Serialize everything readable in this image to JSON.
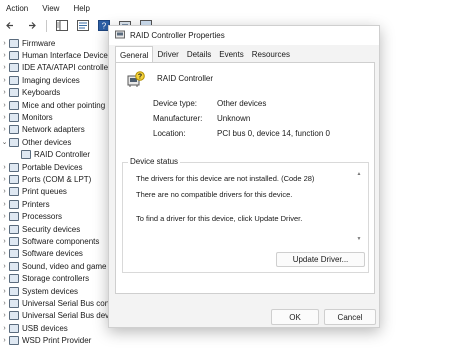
{
  "menubar": {
    "items": [
      "Action",
      "View",
      "Help"
    ]
  },
  "toolbar": {
    "icons": [
      "back-icon",
      "forward-icon",
      "show-hide-tree-icon",
      "properties-icon",
      "help-icon",
      "device-view-icon",
      "monitor-icon"
    ]
  },
  "tree": {
    "items": [
      {
        "label": "Firmware",
        "expanded": false
      },
      {
        "label": "Human Interface Devices",
        "expanded": false
      },
      {
        "label": "IDE ATA/ATAPI controllers",
        "expanded": false
      },
      {
        "label": "Imaging devices",
        "expanded": false
      },
      {
        "label": "Keyboards",
        "expanded": false
      },
      {
        "label": "Mice and other pointing",
        "expanded": false
      },
      {
        "label": "Monitors",
        "expanded": false
      },
      {
        "label": "Network adapters",
        "expanded": false
      },
      {
        "label": "Other devices",
        "expanded": true
      },
      {
        "label": "RAID Controller",
        "child": true
      },
      {
        "label": "Portable Devices",
        "expanded": false
      },
      {
        "label": "Ports (COM & LPT)",
        "expanded": false
      },
      {
        "label": "Print queues",
        "expanded": false
      },
      {
        "label": "Printers",
        "expanded": false
      },
      {
        "label": "Processors",
        "expanded": false
      },
      {
        "label": "Security devices",
        "expanded": false
      },
      {
        "label": "Software components",
        "expanded": false
      },
      {
        "label": "Software devices",
        "expanded": false
      },
      {
        "label": "Sound, video and game",
        "expanded": false
      },
      {
        "label": "Storage controllers",
        "expanded": false
      },
      {
        "label": "System devices",
        "expanded": false
      },
      {
        "label": "Universal Serial Bus cont",
        "expanded": false
      },
      {
        "label": "Universal Serial Bus devi",
        "expanded": false
      },
      {
        "label": "USB devices",
        "expanded": false
      },
      {
        "label": "WSD Print Provider",
        "expanded": false
      }
    ]
  },
  "dialog": {
    "title": "RAID Controller Properties",
    "tabs": [
      "General",
      "Driver",
      "Details",
      "Events",
      "Resources"
    ],
    "active_tab": "General",
    "device_name": "RAID Controller",
    "properties": [
      {
        "label": "Device type:",
        "value": "Other devices"
      },
      {
        "label": "Manufacturer:",
        "value": "Unknown"
      },
      {
        "label": "Location:",
        "value": "PCI bus 0, device 14, function 0"
      }
    ],
    "status_legend": "Device status",
    "status_lines": [
      "The drivers for this device are not installed. (Code 28)",
      "There are no compatible drivers for this device.",
      "To find a driver for this device, click Update Driver."
    ],
    "update_driver_label": "Update Driver...",
    "ok_label": "OK",
    "cancel_label": "Cancel"
  }
}
